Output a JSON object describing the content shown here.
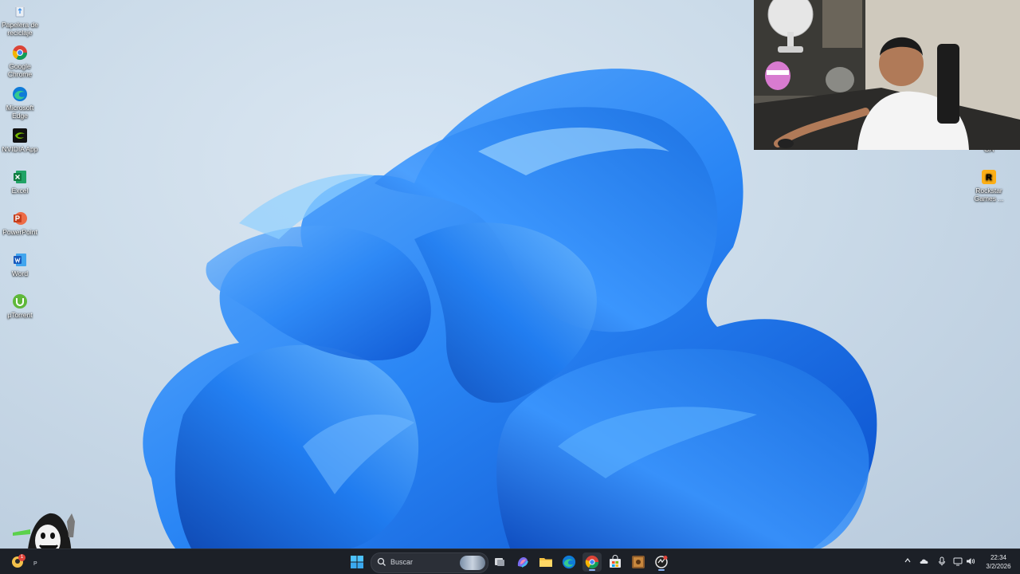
{
  "desktop": {
    "icons_left": [
      {
        "label": "Papelera de reciclaje",
        "icon": "recycle-bin-icon"
      },
      {
        "label": "Google Chrome",
        "icon": "chrome-icon"
      },
      {
        "label": "Microsoft Edge",
        "icon": "edge-icon"
      },
      {
        "label": "NVIDIA App",
        "icon": "nvidia-icon"
      },
      {
        "label": "Excel",
        "icon": "excel-icon"
      },
      {
        "label": "PowerPoint",
        "icon": "powerpoint-icon"
      },
      {
        "label": "Word",
        "icon": "word-icon"
      },
      {
        "label": "µTorrent",
        "icon": "utorrent-icon"
      }
    ],
    "icons_right": [
      {
        "label": "Rockstar Games ...",
        "icon": "rockstar-icon"
      }
    ],
    "partial_label": "GA"
  },
  "taskbar": {
    "search": {
      "placeholder": "Buscar"
    },
    "widget_label": "P",
    "widget_badge": "1",
    "apps": [
      "start-icon",
      "task-view-icon",
      "copilot-icon",
      "file-explorer-icon",
      "edge-icon",
      "chrome-icon",
      "store-icon",
      "game-icon",
      "app-icon"
    ],
    "clock": {
      "time": "22:34",
      "date": "3/2/2026"
    }
  },
  "colors": {
    "taskbar": "#1c2027",
    "accent": "#1a6fe0"
  }
}
